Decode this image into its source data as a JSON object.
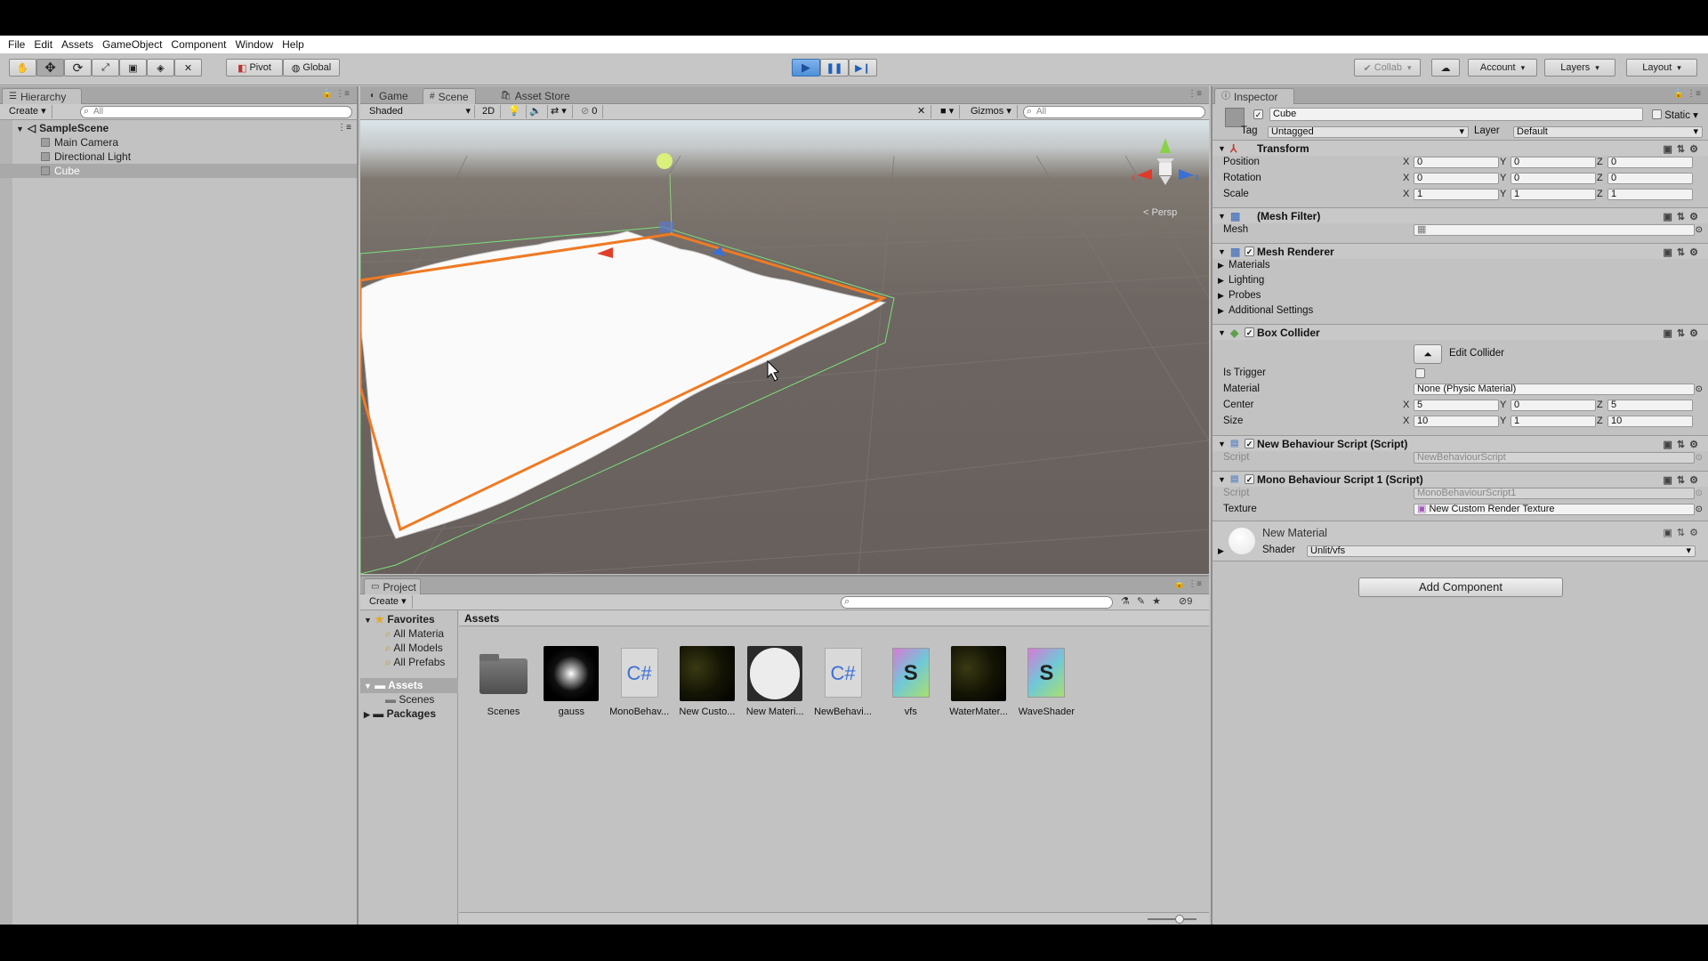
{
  "menubar": [
    "File",
    "Edit",
    "Assets",
    "GameObject",
    "Component",
    "Window",
    "Help"
  ],
  "toolbar": {
    "pivot": "Pivot",
    "global": "Global",
    "collab": "Collab",
    "account": "Account",
    "layers": "Layers",
    "layout": "Layout"
  },
  "hierarchy": {
    "tab": "Hierarchy",
    "create": "Create",
    "search_placeholder": "All",
    "scene": "SampleScene",
    "items": [
      "Main Camera",
      "Directional Light",
      "Cube"
    ]
  },
  "scene_view": {
    "tabs": [
      "Game",
      "Scene",
      "Asset Store"
    ],
    "shading": "Shaded",
    "mode_2d": "2D",
    "hidden_count": "0",
    "gizmos": "Gizmos",
    "search_placeholder": "All",
    "persp": "< Persp"
  },
  "project": {
    "tab": "Project",
    "create": "Create",
    "badge_count": "9",
    "breadcrumb": "Assets",
    "favorites_label": "Favorites",
    "favorites": [
      "All Materia",
      "All Models",
      "All Prefabs"
    ],
    "assets_label": "Assets",
    "asset_children": [
      "Scenes"
    ],
    "packages_label": "Packages",
    "assets": [
      {
        "name": "Scenes",
        "kind": "folder"
      },
      {
        "name": "gauss",
        "kind": "gauss"
      },
      {
        "name": "MonoBehav...",
        "kind": "cs"
      },
      {
        "name": "New Custo...",
        "kind": "dark"
      },
      {
        "name": "New Materi...",
        "kind": "material"
      },
      {
        "name": "NewBehavi...",
        "kind": "cs"
      },
      {
        "name": "vfs",
        "kind": "shader"
      },
      {
        "name": "WaterMater...",
        "kind": "dark"
      },
      {
        "name": "WaveShader",
        "kind": "shader"
      }
    ]
  },
  "inspector": {
    "tab": "Inspector",
    "object_name": "Cube",
    "static_label": "Static",
    "tag_label": "Tag",
    "tag_value": "Untagged",
    "layer_label": "Layer",
    "layer_value": "Default",
    "transform": {
      "title": "Transform",
      "rows": [
        {
          "label": "Position",
          "x": "0",
          "y": "0",
          "z": "0"
        },
        {
          "label": "Rotation",
          "x": "0",
          "y": "0",
          "z": "0"
        },
        {
          "label": "Scale",
          "x": "1",
          "y": "1",
          "z": "1"
        }
      ]
    },
    "mesh_filter": {
      "title": "(Mesh Filter)",
      "mesh_label": "Mesh"
    },
    "mesh_renderer": {
      "title": "Mesh Renderer",
      "sections": [
        "Materials",
        "Lighting",
        "Probes",
        "Additional Settings"
      ]
    },
    "box_collider": {
      "title": "Box Collider",
      "edit_collider": "Edit Collider",
      "is_trigger": "Is Trigger",
      "material_label": "Material",
      "material_value": "None (Physic Material)",
      "center_label": "Center",
      "center": {
        "x": "5",
        "y": "0",
        "z": "5"
      },
      "size_label": "Size",
      "size": {
        "x": "10",
        "y": "1",
        "z": "10"
      }
    },
    "script1": {
      "title": "New Behaviour Script (Script)",
      "script_label": "Script",
      "script_value": "NewBehaviourScript"
    },
    "script2": {
      "title": "Mono Behaviour Script 1 (Script)",
      "script_label": "Script",
      "script_value": "MonoBehaviourScript1",
      "texture_label": "Texture",
      "texture_value": "New Custom Render Texture"
    },
    "material": {
      "name": "New Material",
      "shader_label": "Shader",
      "shader_value": "Unlit/vfs"
    },
    "add_component": "Add Component"
  }
}
